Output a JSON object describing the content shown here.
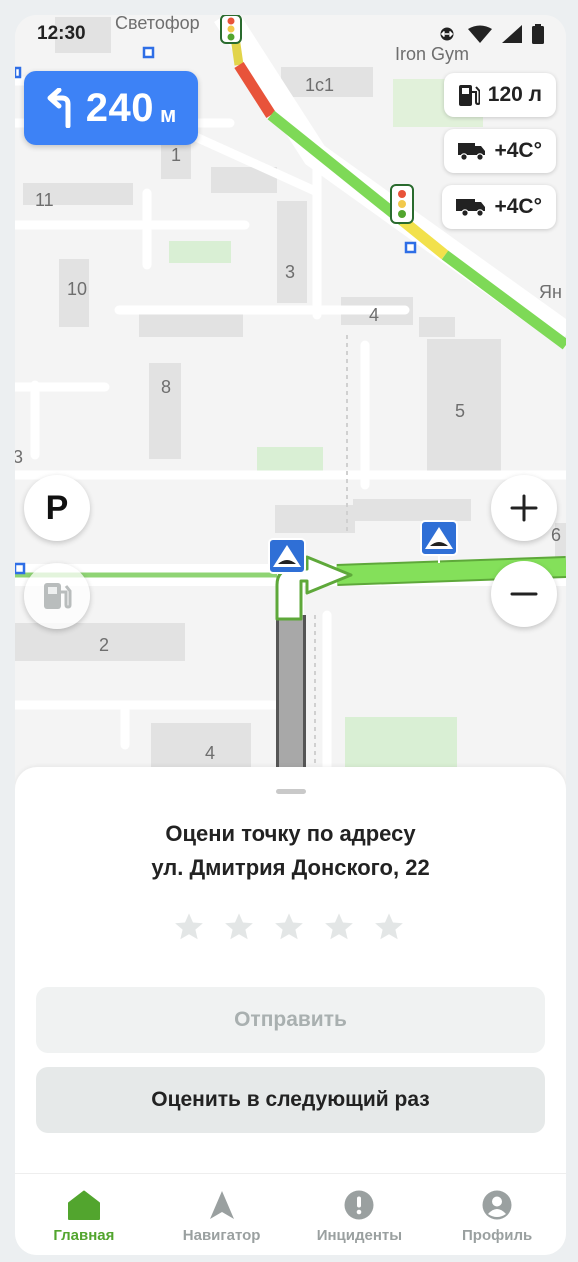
{
  "status_bar": {
    "time": "12:30"
  },
  "map": {
    "labels": {
      "street_svetofor": "Светофор",
      "poi_iron_gym": "Iron Gym",
      "building_1c1": "1с1",
      "building_1": "1",
      "building_11": "11",
      "building_10": "10",
      "building_3": "3",
      "building_4_top": "4",
      "building_8": "8",
      "building_5": "5",
      "building_2": "2",
      "building_4_bottom": "4",
      "building_6": "6",
      "building_3_left": "3",
      "street_yan": "Ян"
    }
  },
  "maneuver": {
    "distance": "240",
    "unit": "м",
    "icon": "turn-left-arrow-icon"
  },
  "info_chips": {
    "fuel": {
      "icon": "fuel-pump-icon",
      "value": "120 л"
    },
    "truck_temp_1": {
      "icon": "truck-icon",
      "value": "+4С°"
    },
    "truck_temp_2": {
      "icon": "trailer-truck-icon",
      "value": "+4С°"
    }
  },
  "map_controls": {
    "parking": {
      "label": "P",
      "icon": "parking-icon"
    },
    "fuel": {
      "icon": "fuel-station-icon"
    },
    "zoom_in": {
      "icon": "plus-icon"
    },
    "zoom_out": {
      "icon": "minus-icon"
    }
  },
  "rating_sheet": {
    "title_line1": "Оцени точку по адресу",
    "title_line2": "ул. Дмитрия Донского, 22",
    "rating": {
      "value": 0,
      "max": 5
    },
    "submit_label": "Отправить",
    "later_label": "Оценить в следующий раз"
  },
  "tab_bar": {
    "active": "home",
    "items": [
      {
        "id": "home",
        "label": "Главная",
        "icon": "home-icon"
      },
      {
        "id": "navigator",
        "label": "Навигатор",
        "icon": "navigation-arrow-icon"
      },
      {
        "id": "incidents",
        "label": "Инциденты",
        "icon": "alert-icon"
      },
      {
        "id": "profile",
        "label": "Профиль",
        "icon": "user-icon"
      }
    ]
  },
  "colors": {
    "accent_blue": "#3d82f6",
    "accent_green": "#52a52e",
    "route_green": "#7ed957",
    "traffic_red": "#e8533a",
    "traffic_yellow": "#f2e14c"
  }
}
